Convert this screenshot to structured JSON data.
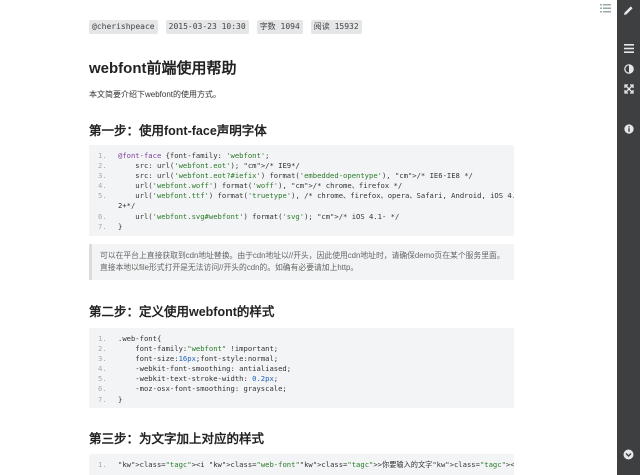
{
  "meta": {
    "author": "@cherishpeace",
    "datetime": "2015-03-23 10:30",
    "word_count": "字数 1094",
    "views": "阅读 15932"
  },
  "title": "webfont前端使用帮助",
  "intro": "本文简要介绍下webfont的使用方式。",
  "step1": {
    "heading": "第一步：使用font-face声明字体",
    "code": [
      {
        "n": "1.",
        "t": "@font-face {font-family: 'webfont';"
      },
      {
        "n": "2.",
        "t": "    src: url('webfont.eot'); /* IE9*/"
      },
      {
        "n": "3.",
        "t": "    src: url('webfont.eot?#iefix') format('embedded-opentype'), /* IE6-IE8 */"
      },
      {
        "n": "4.",
        "t": "    url('webfont.woff') format('woff'), /* chrome、firefox */"
      },
      {
        "n": "5.",
        "t": "    url('webfont.ttf') format('truetype'), /* chrome、firefox、opera、Safari, Android, iOS 4."
      },
      {
        "n": "",
        "t": "2+*/"
      },
      {
        "n": "6.",
        "t": "    url('webfont.svg#webfont') format('svg'); /* iOS 4.1- */"
      },
      {
        "n": "7.",
        "t": "}"
      }
    ]
  },
  "note": "可以在平台上直接获取到cdn地址替换。由于cdn地址以//开头，因此使用cdn地址时，请确保demo页在某个服务里面。直接本地以file形式打开是无法访问//开头的cdn的。如确有必要请加上http。",
  "step2": {
    "heading": "第二步：定义使用webfont的样式",
    "code": [
      {
        "n": "1.",
        "t": ".web-font{"
      },
      {
        "n": "2.",
        "t": "    font-family:\"webfont\" !important;"
      },
      {
        "n": "3.",
        "t": "    font-size:16px;font-style:normal;"
      },
      {
        "n": "4.",
        "t": "    -webkit-font-smoothing: antialiased;"
      },
      {
        "n": "5.",
        "t": "    -webkit-text-stroke-width: 0.2px;"
      },
      {
        "n": "6.",
        "t": "    -moz-osx-font-smoothing: grayscale;"
      },
      {
        "n": "7.",
        "t": "}"
      }
    ]
  },
  "step3": {
    "heading": "第三步：为文字加上对应的样式",
    "code": [
      {
        "n": "1.",
        "t": "<i class=\"web-font\">你要输入的文字</i>"
      }
    ]
  },
  "icons": {
    "toc": "list-icon",
    "rail": [
      "edit-icon",
      "menu-icon",
      "contrast-icon",
      "fullscreen-icon",
      "info-icon",
      "scroll-down-icon"
    ]
  },
  "colors": {
    "rail_bg": "#3e3f41",
    "code_bg": "#f3f4f5",
    "tag_bg": "#e4e6e8"
  }
}
